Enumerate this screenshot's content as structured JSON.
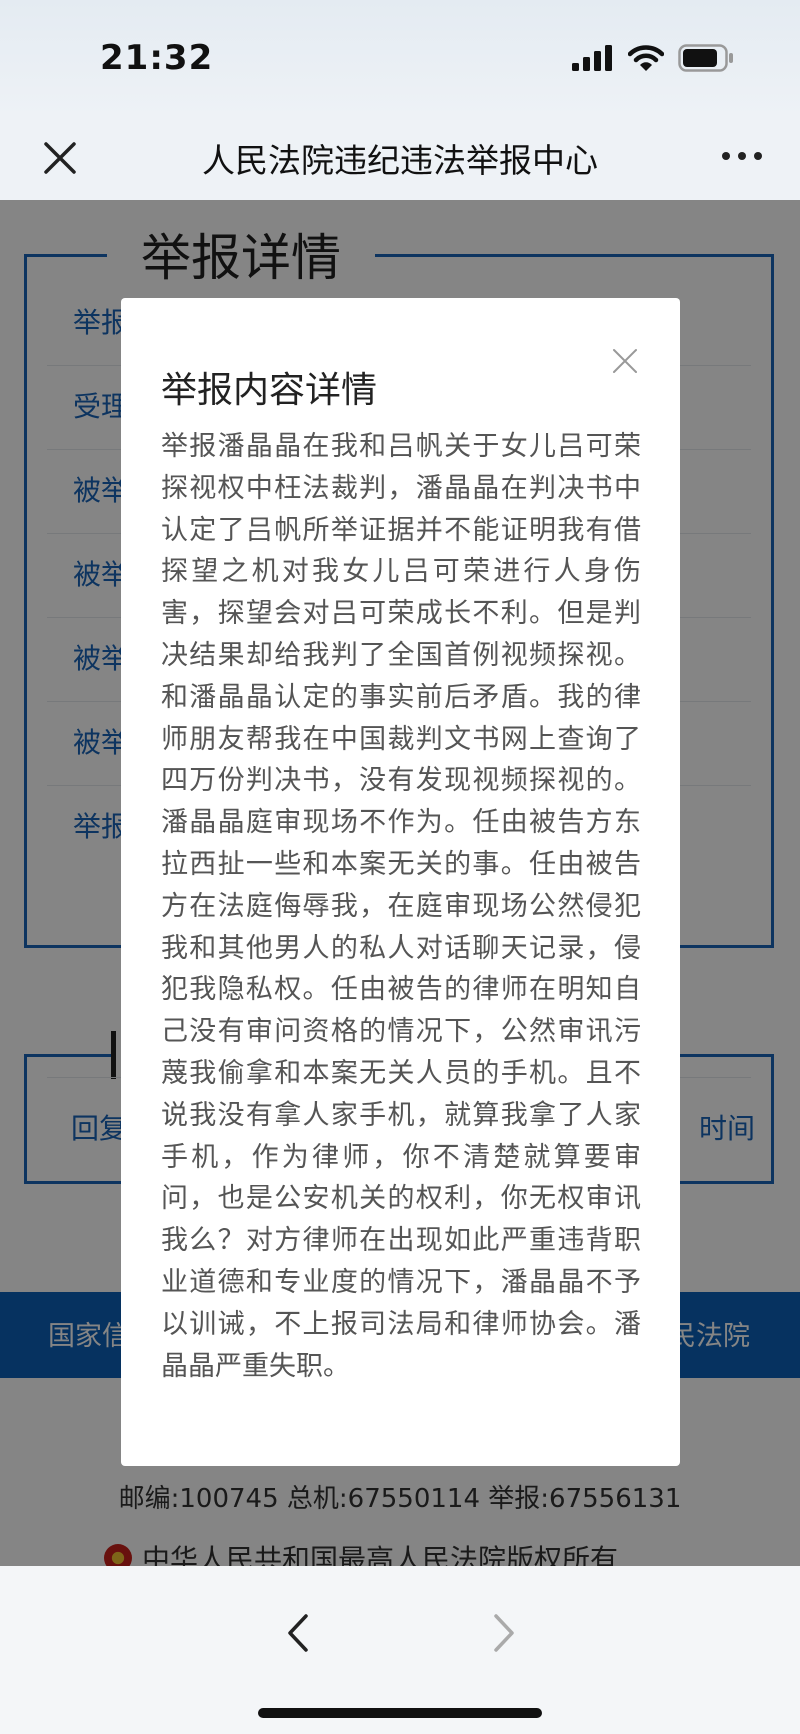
{
  "status_bar": {
    "time": "21:32"
  },
  "nav": {
    "title": "人民法院违纪违法举报中心"
  },
  "page": {
    "report_heading": "举报详情",
    "row_labels": [
      "举报",
      "受理",
      "被举",
      "被举",
      "被举",
      "被举",
      "举报"
    ],
    "reply_left": "回复",
    "reply_right": "时间",
    "band_left": "国家信",
    "band_right": "民法院",
    "contact": "邮编:100745   总机:67550114    举报:67556131",
    "copyright": "中华人民共和国最高人民法院版权所有"
  },
  "modal": {
    "title": "举报内容详情",
    "body": "举报潘晶晶在我和吕帆关于女儿吕可荣探视权中枉法裁判，潘晶晶在判决书中认定了吕帆所举证据并不能证明我有借探望之机对我女儿吕可荣进行人身伤害，探望会对吕可荣成长不利。但是判决结果却给我判了全国首例视频探视。和潘晶晶认定的事实前后矛盾。我的律师朋友帮我在中国裁判文书网上查询了四万份判决书，没有发现视频探视的。潘晶晶庭审现场不作为。任由被告方东拉西扯一些和本案无关的事。任由被告方在法庭侮辱我，在庭审现场公然侵犯我和其他男人的私人对话聊天记录，侵犯我隐私权。任由被告的律师在明知自己没有审问资格的情况下，公然审讯污蔑我偷拿和本案无关人员的手机。且不说我没有拿人家手机，就算我拿了人家手机，作为律师，你不清楚就算要审问，也是公安机关的权利，你无权审讯我么？对方律师在出现如此严重违背职业道德和专业度的情况下，潘晶晶不予以训诫，不上报司法局和律师协会。潘晶晶严重失职。"
  },
  "colors": {
    "accent_blue": "#1a64b8",
    "band_blue": "#0c60b8"
  },
  "icons": {
    "signal": "signal-icon",
    "wifi": "wifi-icon",
    "battery": "battery-icon",
    "close": "close-icon",
    "more": "more-icon",
    "back": "chevron-left-icon",
    "forward": "chevron-right-icon",
    "emblem": "court-emblem-icon"
  }
}
